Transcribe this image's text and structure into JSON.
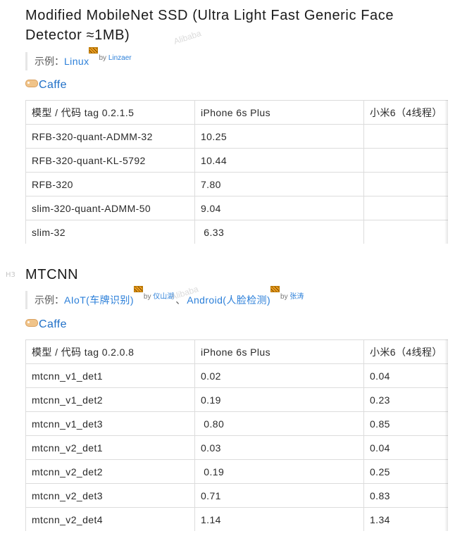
{
  "section1": {
    "heading": "Modified MobileNet SSD (Ultra Light Fast Generic Face Detector ≈1MB)",
    "example_prefix": "示例：",
    "examples": [
      {
        "label": "Linux",
        "by": "by",
        "author": "Linzaer"
      }
    ],
    "framework": "Caffe",
    "table": {
      "header": [
        "模型 / 代码 tag 0.2.1.5",
        "iPhone 6s Plus",
        "小米6（4线程）"
      ],
      "rows": [
        [
          "RFB-320-quant-ADMM-32",
          "10.25",
          ""
        ],
        [
          "RFB-320-quant-KL-5792",
          "10.44",
          ""
        ],
        [
          "RFB-320",
          "7.80",
          ""
        ],
        [
          "slim-320-quant-ADMM-50",
          "9.04",
          ""
        ],
        [
          "slim-32",
          " 6.33",
          ""
        ]
      ]
    }
  },
  "section2": {
    "heading_marker": "H3",
    "heading": "MTCNN",
    "example_prefix": "示例：",
    "examples": [
      {
        "label": "AIoT(车牌识别)",
        "by": "by",
        "author": "仪山湖"
      },
      {
        "label": "Android(人脸检测)",
        "by": "by",
        "author": "张涛"
      }
    ],
    "separator": "、",
    "framework": "Caffe",
    "table": {
      "header": [
        "模型 / 代码 tag 0.2.0.8",
        "iPhone 6s Plus",
        "小米6（4线程）"
      ],
      "rows": [
        [
          "mtcnn_v1_det1",
          "0.02",
          "0.04"
        ],
        [
          "mtcnn_v1_det2",
          "0.19",
          "0.23"
        ],
        [
          "mtcnn_v1_det3",
          " 0.80",
          "0.85"
        ],
        [
          "mtcnn_v2_det1",
          "0.03",
          "0.04"
        ],
        [
          "mtcnn_v2_det2",
          " 0.19",
          "0.25"
        ],
        [
          "mtcnn_v2_det3",
          "0.71",
          "0.83"
        ],
        [
          "mtcnn_v2_det4",
          "1.14",
          "1.34"
        ]
      ]
    }
  },
  "watermark": "Alibaba"
}
